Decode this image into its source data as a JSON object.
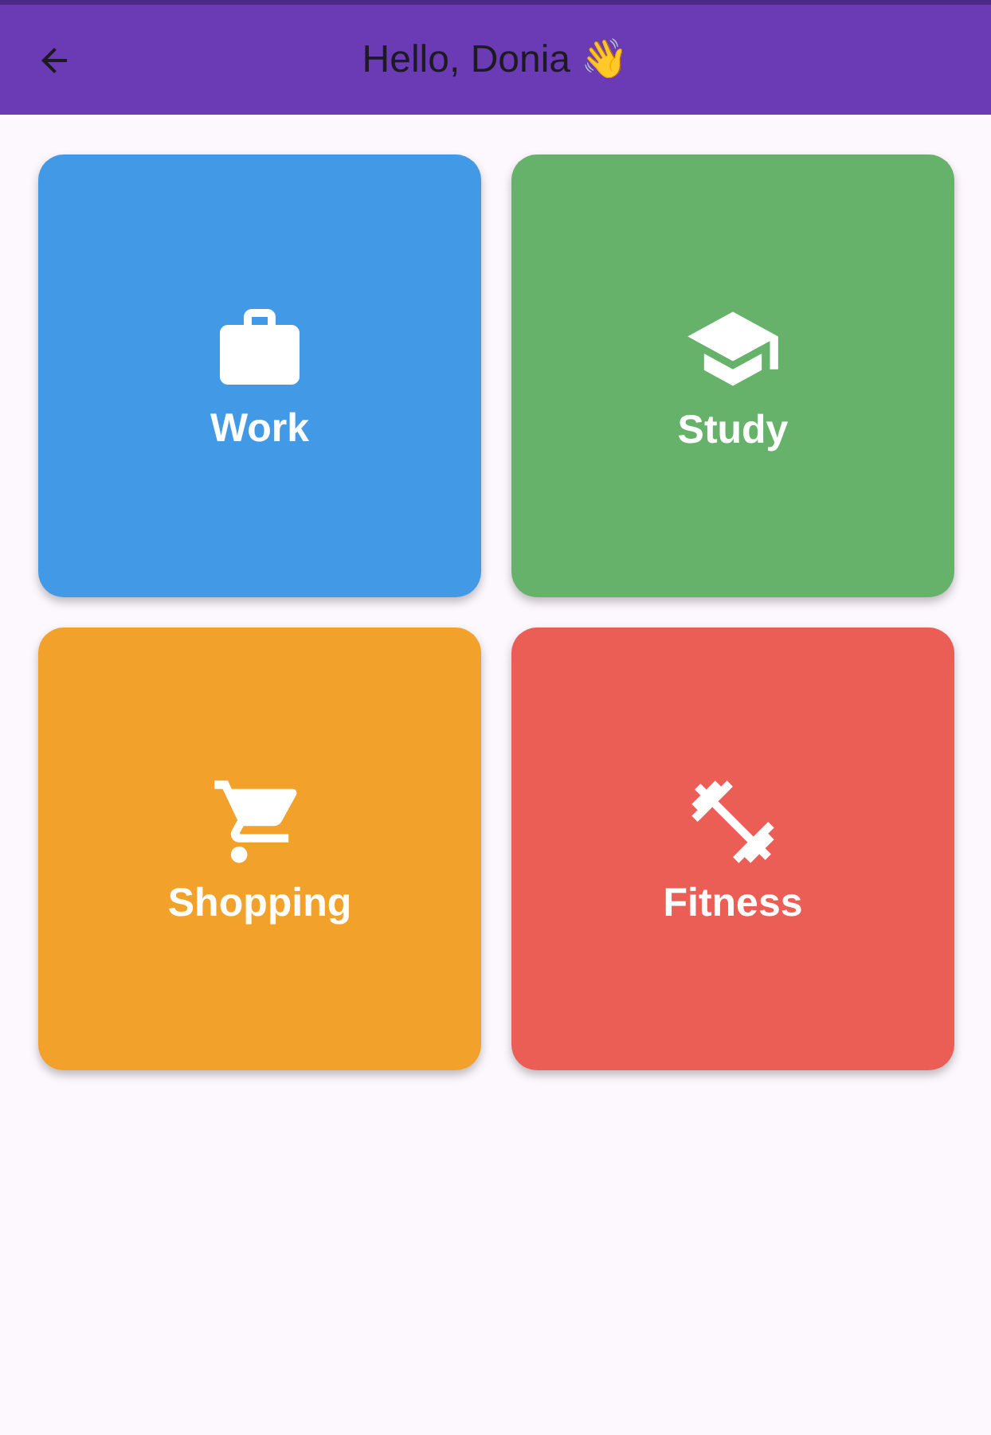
{
  "app_bar": {
    "title": "Hello, Donia 👋"
  },
  "categories": [
    {
      "label": "Work",
      "kind": "briefcase",
      "color": "#4299e6"
    },
    {
      "label": "Study",
      "kind": "cap",
      "color": "#66b26b"
    },
    {
      "label": "Shopping",
      "kind": "cart",
      "color": "#f2a12b"
    },
    {
      "label": "Fitness",
      "kind": "dumbbell",
      "color": "#eb5e55"
    }
  ]
}
